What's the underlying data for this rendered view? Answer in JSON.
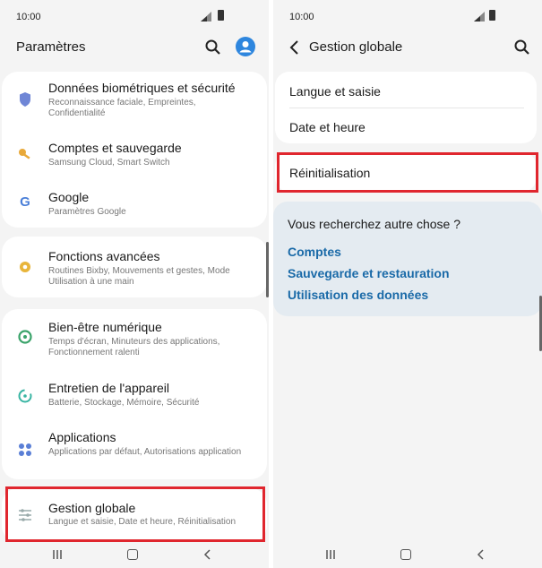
{
  "status": {
    "time": "10:00"
  },
  "left": {
    "title": "Paramètres",
    "groups": [
      [
        {
          "title": "Données biométriques et sécurité",
          "subtitle": "Reconnaissance faciale, Empreintes, Confidentialité",
          "icon": "shield-icon"
        },
        {
          "title": "Comptes et sauvegarde",
          "subtitle": "Samsung Cloud, Smart Switch",
          "icon": "key-icon"
        },
        {
          "title": "Google",
          "subtitle": "Paramètres Google",
          "icon": "google-icon"
        }
      ],
      [
        {
          "title": "Fonctions avancées",
          "subtitle": "Routines Bixby, Mouvements et gestes, Mode Utilisation à une main",
          "icon": "gear-plus-icon"
        }
      ],
      [
        {
          "title": "Bien-être numérique",
          "subtitle": "Temps d'écran, Minuteurs des applications, Fonctionnement ralenti",
          "icon": "wellbeing-icon"
        },
        {
          "title": "Entretien de l'appareil",
          "subtitle": "Batterie, Stockage, Mémoire, Sécurité",
          "icon": "device-care-icon"
        },
        {
          "title": "Applications",
          "subtitle": "Applications par défaut, Autorisations application",
          "icon": "apps-icon"
        }
      ]
    ],
    "general": {
      "title": "Gestion globale",
      "subtitle": "Langue et saisie, Date et heure, Réinitialisation",
      "icon": "sliders-icon"
    }
  },
  "right": {
    "title": "Gestion globale",
    "items": [
      "Langue et saisie",
      "Date et heure"
    ],
    "reset": "Réinitialisation",
    "suggest": {
      "question": "Vous recherchez autre chose ?",
      "links": [
        "Comptes",
        "Sauvegarde et restauration",
        "Utilisation des données"
      ]
    }
  },
  "colors": {
    "accent": "#2e86de",
    "highlight": "#e0262e",
    "link": "#1a6aa8",
    "suggest_bg": "#e4ebf1"
  }
}
